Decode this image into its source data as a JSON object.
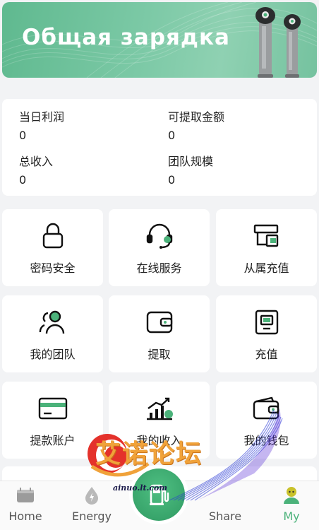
{
  "banner": {
    "title": "Общая зарядка"
  },
  "stats": [
    {
      "label": "当日利润",
      "value": "0"
    },
    {
      "label": "可提取金额",
      "value": "0"
    },
    {
      "label": "总收入",
      "value": "0"
    },
    {
      "label": "团队规模",
      "value": "0"
    }
  ],
  "tiles": [
    {
      "label": "密码安全",
      "icon": "lock-icon"
    },
    {
      "label": "在线服务",
      "icon": "headset-icon"
    },
    {
      "label": "从属充值",
      "icon": "sub-recharge-icon"
    },
    {
      "label": "我的团队",
      "icon": "team-icon"
    },
    {
      "label": "提取",
      "icon": "wallet-icon"
    },
    {
      "label": "充值",
      "icon": "recharge-icon"
    },
    {
      "label": "提款账户",
      "icon": "card-icon"
    },
    {
      "label": "我的收入",
      "icon": "income-chart-icon"
    },
    {
      "label": "我的钱包",
      "icon": "purse-icon"
    }
  ],
  "nav": {
    "items": [
      {
        "label": "Home",
        "icon": "home-icon"
      },
      {
        "label": "Energy",
        "icon": "energy-icon"
      },
      {
        "label": "Share",
        "icon": "share-icon"
      },
      {
        "label": "My",
        "icon": "my-icon"
      }
    ],
    "active": "My",
    "center_icon": "charging-station-icon"
  },
  "watermark": {
    "text": "艾诺论坛",
    "sub": "ainuo.lt.com"
  },
  "colors": {
    "accent": "#4bb27a",
    "banner": "#6fc39c",
    "background": "#f2f3f5"
  }
}
